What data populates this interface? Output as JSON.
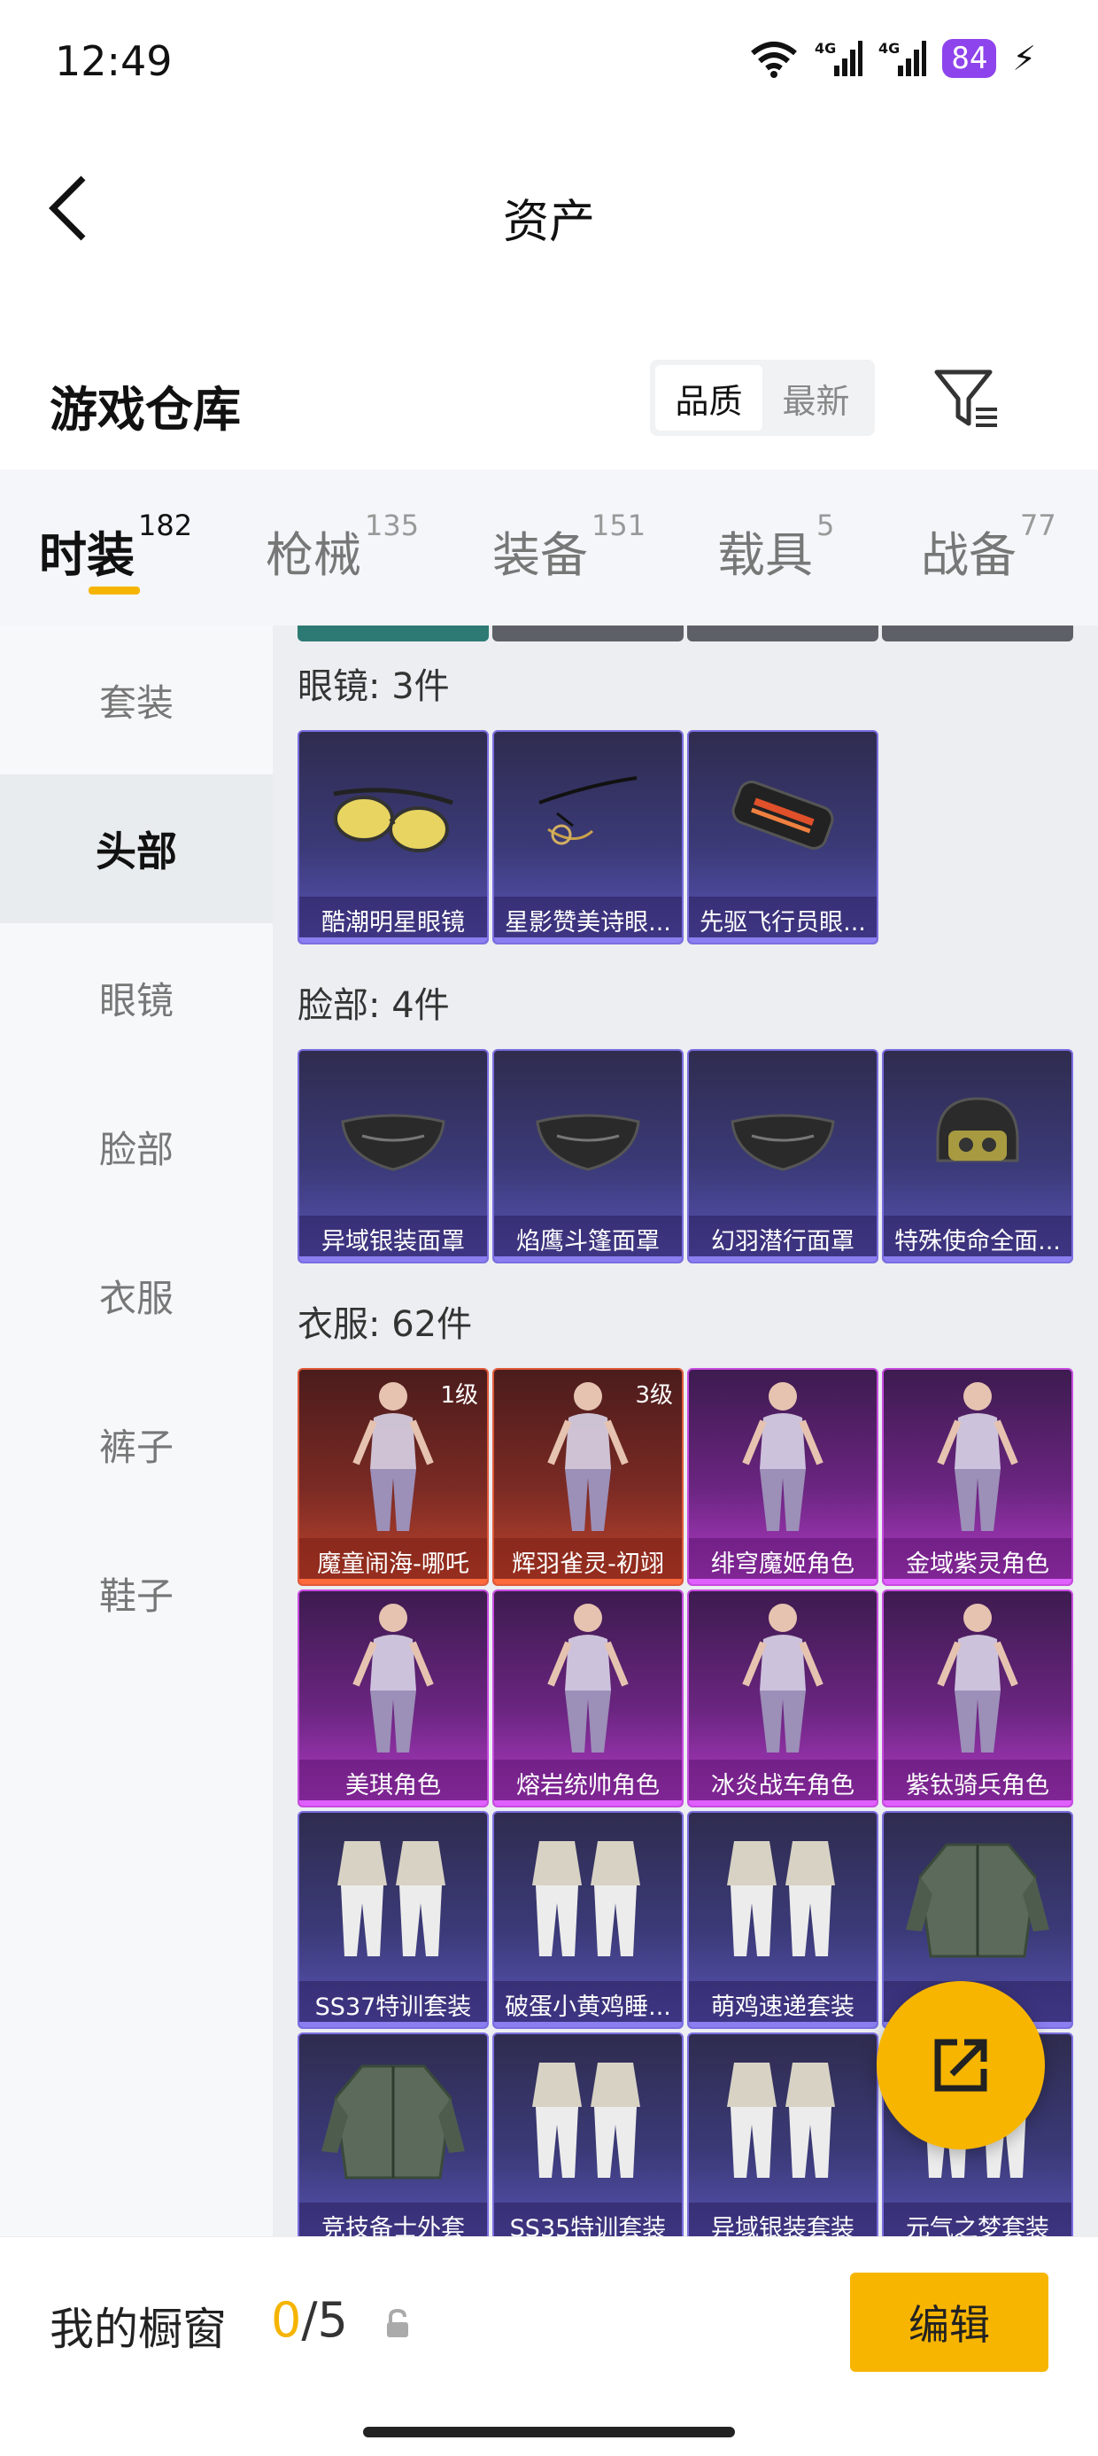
{
  "status_bar": {
    "time": "12:49",
    "battery": "84",
    "network_1": "4G",
    "network_2": "4G"
  },
  "header": {
    "title": "资产"
  },
  "warehouse": {
    "title": "游戏仓库",
    "sort_options": [
      "品质",
      "最新"
    ],
    "sort_active": "品质"
  },
  "tabs": [
    {
      "label": "时装",
      "count": "182",
      "active": true
    },
    {
      "label": "枪械",
      "count": "135",
      "active": false
    },
    {
      "label": "装备",
      "count": "151",
      "active": false
    },
    {
      "label": "载具",
      "count": "5",
      "active": false
    },
    {
      "label": "战备",
      "count": "77",
      "active": false
    }
  ],
  "side_nav": [
    {
      "label": "套装",
      "active": false
    },
    {
      "label": "头部",
      "active": true
    },
    {
      "label": "眼镜",
      "active": false
    },
    {
      "label": "脸部",
      "active": false
    },
    {
      "label": "衣服",
      "active": false
    },
    {
      "label": "裤子",
      "active": false
    },
    {
      "label": "鞋子",
      "active": false
    }
  ],
  "sections": [
    {
      "title": "眼镜: 3件",
      "items": [
        {
          "name": "酷潮明星眼镜",
          "rarity": "blue",
          "icon": "sunglasses-icon"
        },
        {
          "name": "星影赞美诗眼...",
          "rarity": "blue",
          "icon": "necklace-glasses-icon"
        },
        {
          "name": "先驱飞行员眼...",
          "rarity": "blue",
          "icon": "visor-goggles-icon"
        }
      ]
    },
    {
      "title": "脸部: 4件",
      "items": [
        {
          "name": "异域银装面罩",
          "rarity": "blue",
          "icon": "mask-icon"
        },
        {
          "name": "焰鹰斗篷面罩",
          "rarity": "blue",
          "icon": "mask-icon"
        },
        {
          "name": "幻羽潜行面罩",
          "rarity": "blue",
          "icon": "mask-icon"
        },
        {
          "name": "特殊使命全面...",
          "rarity": "blue",
          "icon": "helmet-icon"
        }
      ]
    },
    {
      "title": "衣服: 62件",
      "items": [
        {
          "name": "魔童闹海-哪吒",
          "rarity": "red",
          "level": "1级",
          "icon": "character-icon"
        },
        {
          "name": "辉羽雀灵-初翊",
          "rarity": "red",
          "level": "3级",
          "icon": "character-icon"
        },
        {
          "name": "绯穹魔姬角色",
          "rarity": "pink",
          "icon": "character-icon"
        },
        {
          "name": "金域紫灵角色",
          "rarity": "pink",
          "icon": "character-icon"
        },
        {
          "name": "美琪角色",
          "rarity": "pink",
          "icon": "character-icon"
        },
        {
          "name": "熔岩统帅角色",
          "rarity": "pink",
          "icon": "character-icon"
        },
        {
          "name": "冰炎战车角色",
          "rarity": "pink",
          "icon": "character-icon"
        },
        {
          "name": "紫钛骑兵角色",
          "rarity": "pink",
          "icon": "character-icon"
        },
        {
          "name": "SS37特训套装",
          "rarity": "blue",
          "icon": "outfit-icon"
        },
        {
          "name": "破蛋小黄鸡睡...",
          "rarity": "blue",
          "icon": "outfit-icon"
        },
        {
          "name": "萌鸡速递套装",
          "rarity": "blue",
          "icon": "outfit-icon"
        },
        {
          "name": "装",
          "rarity": "blue",
          "icon": "jacket-icon"
        },
        {
          "name": "竞技备士外套",
          "rarity": "blue",
          "icon": "jacket-icon"
        },
        {
          "name": "SS35特训套装",
          "rarity": "blue",
          "icon": "outfit-icon"
        },
        {
          "name": "异域银装套装",
          "rarity": "blue",
          "icon": "outfit-icon"
        },
        {
          "name": "元气之梦套装",
          "rarity": "blue",
          "icon": "outfit-icon"
        }
      ]
    }
  ],
  "bottom_bar": {
    "label": "我的橱窗",
    "current": "0",
    "total": "/5",
    "edit_label": "编辑"
  }
}
